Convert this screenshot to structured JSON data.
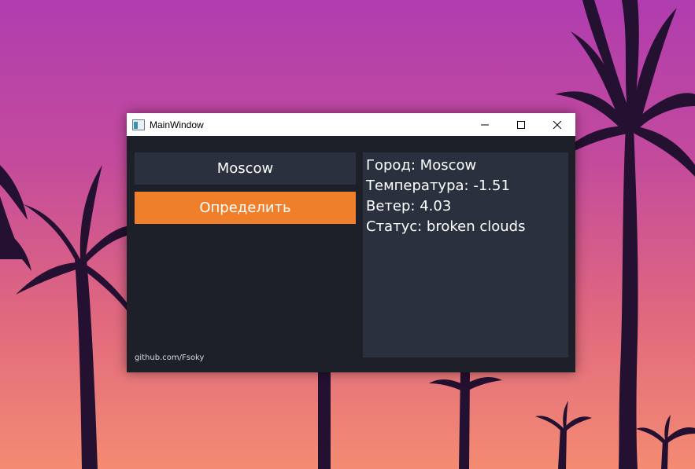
{
  "window": {
    "title": "MainWindow",
    "controls": [
      "minimize-icon",
      "maximize-icon",
      "close-icon"
    ]
  },
  "form": {
    "city_value": "Moscow",
    "detect_label": "Определить"
  },
  "result": {
    "lines": [
      "Город: Moscow",
      "Температура: -1.51",
      "Ветер: 4.03",
      "Статус: broken clouds"
    ]
  },
  "footer": {
    "link": "github.com/Fsoky"
  },
  "colors": {
    "window_bg": "#1d2029",
    "panel_bg": "#2b303e",
    "accent": "#ef7f2a",
    "text": "#ffffff"
  }
}
